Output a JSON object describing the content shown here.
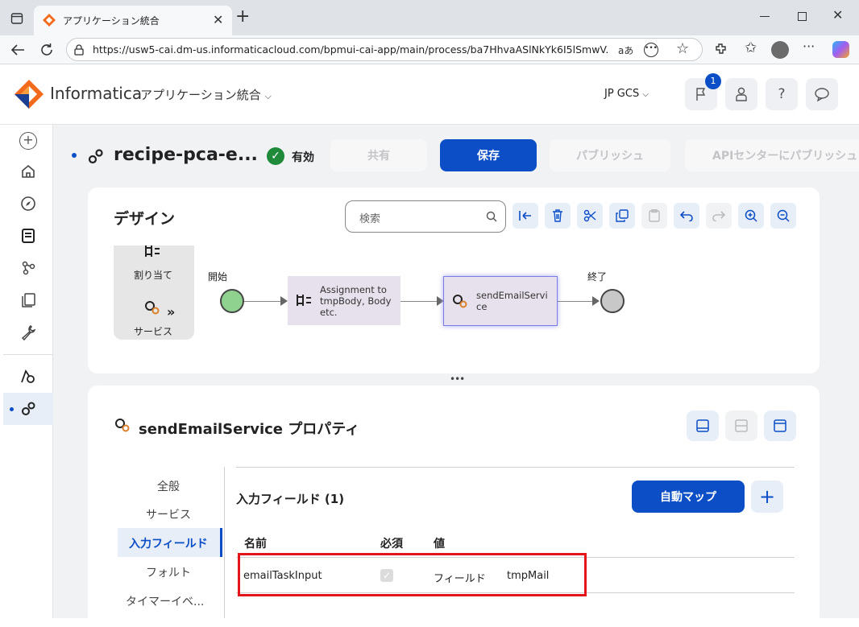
{
  "browser": {
    "tab_title": "アプリケーション統合",
    "url": "https://usw5-cai.dm-us.informaticacloud.com/bpmui-cai-app/main/process/ba7HhvaASlNkYk6I5lSmwV...",
    "reader_label": "aあ"
  },
  "app": {
    "brand": "Informatica",
    "product": "アプリケーション統合",
    "org": "JP GCS",
    "notification_count": "1"
  },
  "process": {
    "name": "recipe-pca-e...",
    "status": "有効",
    "buttons": {
      "share": "共有",
      "save": "保存",
      "publish": "パブリッシュ",
      "publish_api": "APIセンターにパブリッシュ"
    }
  },
  "design": {
    "title": "デザイン",
    "search_placeholder": "検索",
    "palette": {
      "assign": "割り当て",
      "service": "サービス"
    },
    "nodes": {
      "start": "開始",
      "assignment": "Assignment to tmpBody, Body etc.",
      "service": "sendEmailService",
      "end": "終了"
    }
  },
  "properties": {
    "title": "sendEmailService プロパティ",
    "nav": [
      "全般",
      "サービス",
      "入力フィールド",
      "フォルト",
      "タイマーイベ..."
    ],
    "active_nav": "入力フィールド",
    "section_title": "入力フィールド (1)",
    "auto_map": "自動マップ",
    "table": {
      "headers": [
        "名前",
        "必須",
        "値"
      ],
      "rows": [
        {
          "name": "emailTaskInput",
          "required": true,
          "value_type": "フィールド",
          "value": "tmpMail"
        }
      ]
    }
  },
  "colors": {
    "brand_blue": "#0b4ec6",
    "status_green": "#1f8a3a",
    "start_node": "#8fd28f",
    "end_node": "#c8c8c8",
    "highlight": "#e3151a"
  }
}
